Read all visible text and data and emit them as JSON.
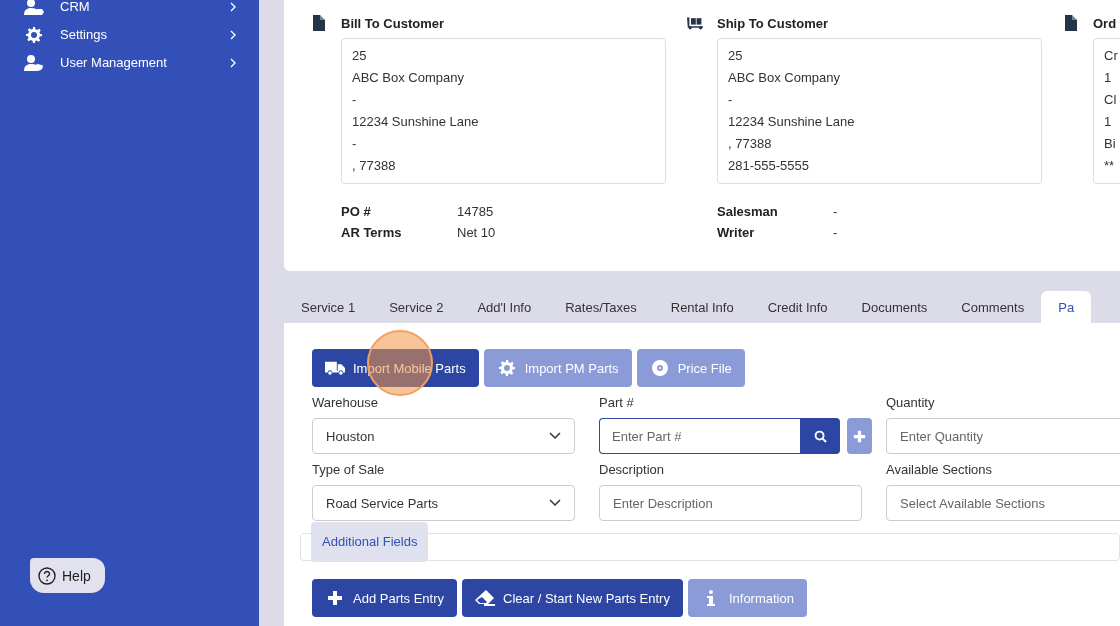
{
  "sidebar": {
    "items": [
      {
        "label": "CRM"
      },
      {
        "label": "Settings"
      },
      {
        "label": "User Management"
      }
    ],
    "help": "Help"
  },
  "customers": [
    {
      "title": "Bill To Customer",
      "lines": [
        "25",
        "ABC Box Company",
        "-",
        "12234 Sunshine Lane",
        "-",
        ", 77388"
      ],
      "details": [
        {
          "label": "PO #",
          "value": "14785"
        },
        {
          "label": "AR Terms",
          "value": "Net 10"
        }
      ]
    },
    {
      "title": "Ship To Customer",
      "lines": [
        "25",
        "ABC Box Company",
        "-",
        "12234 Sunshine Lane",
        ", 77388",
        "281-555-5555"
      ],
      "details": [
        {
          "label": "Salesman",
          "value": "-"
        },
        {
          "label": "Writer",
          "value": "-"
        }
      ]
    },
    {
      "title": "Ord",
      "lines": [
        "Cr",
        "1",
        "Cl",
        "1",
        "Bi",
        "**"
      ]
    }
  ],
  "tabs": [
    {
      "label": "Service 1",
      "selected": false
    },
    {
      "label": "Service 2",
      "selected": false
    },
    {
      "label": "Add'l Info",
      "selected": false
    },
    {
      "label": "Rates/Taxes",
      "selected": false
    },
    {
      "label": "Rental Info",
      "selected": false
    },
    {
      "label": "Credit Info",
      "selected": false
    },
    {
      "label": "Documents",
      "selected": false
    },
    {
      "label": "Comments",
      "selected": false
    },
    {
      "label": "Pa",
      "selected": true
    }
  ],
  "import_buttons": [
    {
      "label": "Import Mobile Parts",
      "disabled": false
    },
    {
      "label": "Import PM Parts",
      "disabled": true
    },
    {
      "label": "Price File",
      "disabled": true
    }
  ],
  "fields": [
    {
      "label": "Warehouse",
      "kind": "select",
      "value": "Houston"
    },
    {
      "label": "Part #",
      "kind": "search",
      "placeholder": "Enter Part #"
    },
    {
      "label": "Quantity",
      "kind": "input",
      "placeholder": "Enter Quantity"
    },
    {
      "label": "Type of Sale",
      "kind": "select",
      "value": "Road Service Parts"
    },
    {
      "label": "Description",
      "kind": "input",
      "placeholder": "Enter Description"
    },
    {
      "label": "Available Sections",
      "kind": "select",
      "placeholder": "Select Available Sections"
    }
  ],
  "additional_fields": "Additional Fields",
  "bottom_buttons": [
    {
      "label": "Add Parts Entry",
      "disabled": false
    },
    {
      "label": "Clear / Start New Parts Entry",
      "disabled": false
    },
    {
      "label": "Information",
      "disabled": true
    }
  ]
}
